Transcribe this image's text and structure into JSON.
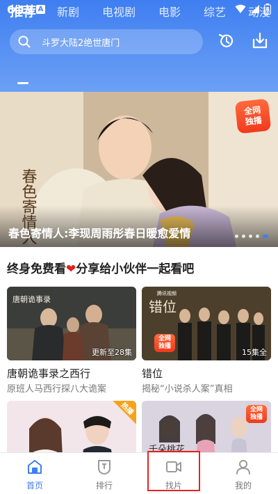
{
  "status_bar": {
    "time": "6:19",
    "badge": "A"
  },
  "search": {
    "placeholder": "斗罗大陆2绝世唐门"
  },
  "tabs": [
    {
      "label": "推荐",
      "active": true
    },
    {
      "label": "新剧",
      "active": false
    },
    {
      "label": "电视剧",
      "active": false
    },
    {
      "label": "电影",
      "active": false
    },
    {
      "label": "综艺",
      "active": false
    },
    {
      "label": "动漫",
      "active": false
    }
  ],
  "banner": {
    "caption": "春色寄情人:李现周雨彤春日暖愈爱情",
    "badge_line1": "全网",
    "badge_line2": "独播",
    "calligraphy": "春色寄情人"
  },
  "section": {
    "title_part1": "终身免费看",
    "title_part2": "分享给小伙伴一起看吧"
  },
  "cards": [
    {
      "title": "唐朝诡事录之西行",
      "subtitle": "原班人马西行探八大诡案",
      "episodes": "更新至28集",
      "poster_text": "唐朝诡事录",
      "badge": ""
    },
    {
      "title": "错位",
      "subtitle": "揭秘“小说杀人案”真相",
      "episodes": "15集全",
      "poster_text": "错位",
      "badge_line1": "全网",
      "badge_line2": "独播",
      "logo_text": "腾讯视频"
    },
    {
      "hot_label": "热播"
    },
    {
      "poster_text": "千朵桃花",
      "badge_line1": "全网",
      "badge_line2": "独播"
    }
  ],
  "bottom_nav": [
    {
      "label": "首页",
      "icon": "home-icon",
      "active": true
    },
    {
      "label": "排行",
      "icon": "ranking-icon",
      "active": false
    },
    {
      "label": "找片",
      "icon": "video-search-icon",
      "active": false
    },
    {
      "label": "我的",
      "icon": "profile-icon",
      "active": false
    }
  ],
  "colors": {
    "accent": "#3f7ef1",
    "highlight": "#e02424",
    "badge": "#f03a1c"
  }
}
